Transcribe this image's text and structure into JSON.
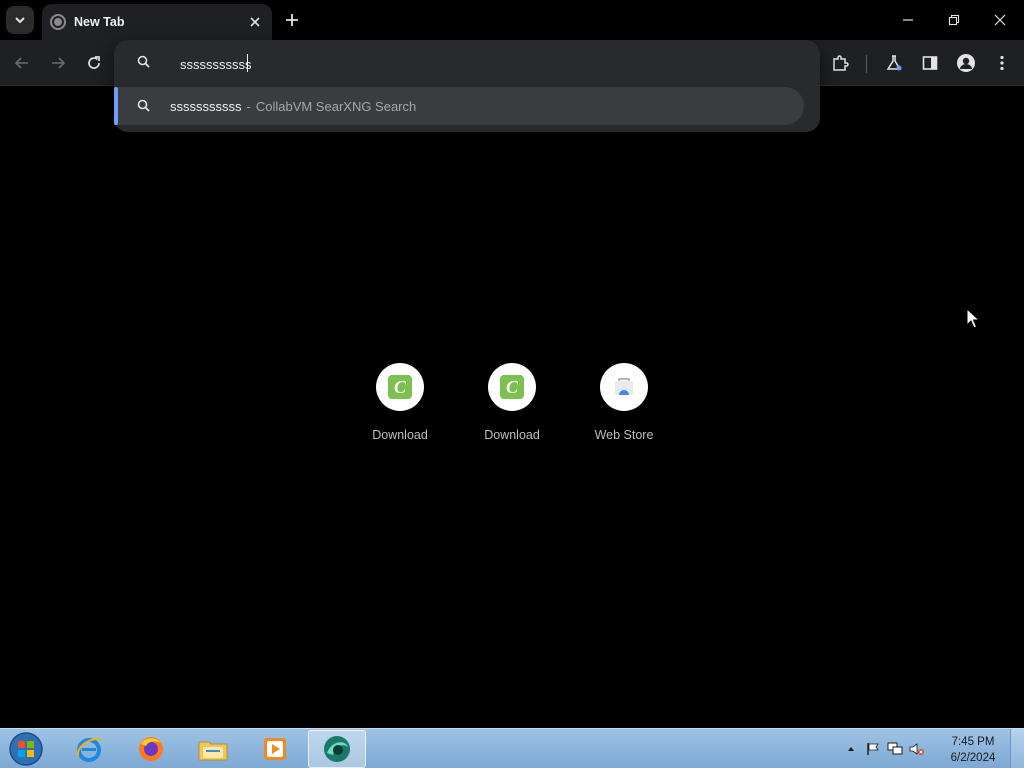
{
  "browser": {
    "tab": {
      "title": "New Tab"
    },
    "omnibox": {
      "input_value": "sssssssssss",
      "suggestion": {
        "query": "sssssssssss",
        "separator": "-",
        "engine": "CollabVM SearXNG Search"
      }
    },
    "accent_color": "#6aa0f8",
    "shortcuts": [
      {
        "label": "Download",
        "icon": "green-c-icon"
      },
      {
        "label": "Download",
        "icon": "green-c-icon"
      },
      {
        "label": "Web Store",
        "icon": "web-store-icon"
      }
    ]
  },
  "taskbar": {
    "apps": [
      "internet-explorer-icon",
      "firefox-icon",
      "file-explorer-icon",
      "media-player-icon",
      "browser-icon"
    ],
    "clock": {
      "time": "7:45 PM",
      "date": "6/2/2024"
    }
  }
}
